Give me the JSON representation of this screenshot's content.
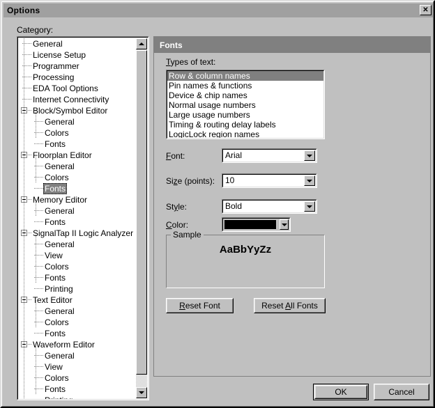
{
  "window": {
    "title": "Options",
    "close_label": "✕"
  },
  "left": {
    "category_label": "Category:",
    "tree": [
      {
        "label": "General",
        "depth": 1,
        "expander": false
      },
      {
        "label": "License Setup",
        "depth": 1,
        "expander": false
      },
      {
        "label": "Programmer",
        "depth": 1,
        "expander": false
      },
      {
        "label": "Processing",
        "depth": 1,
        "expander": false
      },
      {
        "label": "EDA Tool Options",
        "depth": 1,
        "expander": false
      },
      {
        "label": "Internet Connectivity",
        "depth": 1,
        "expander": false
      },
      {
        "label": "Block/Symbol Editor",
        "depth": 1,
        "expander": true
      },
      {
        "label": "General",
        "depth": 2,
        "expander": false
      },
      {
        "label": "Colors",
        "depth": 2,
        "expander": false
      },
      {
        "label": "Fonts",
        "depth": 2,
        "expander": false
      },
      {
        "label": "Floorplan Editor",
        "depth": 1,
        "expander": true
      },
      {
        "label": "General",
        "depth": 2,
        "expander": false
      },
      {
        "label": "Colors",
        "depth": 2,
        "expander": false
      },
      {
        "label": "Fonts",
        "depth": 2,
        "expander": false,
        "selected": true
      },
      {
        "label": "Memory Editor",
        "depth": 1,
        "expander": true
      },
      {
        "label": "General",
        "depth": 2,
        "expander": false
      },
      {
        "label": "Fonts",
        "depth": 2,
        "expander": false
      },
      {
        "label": "SignalTap II Logic Analyzer",
        "depth": 1,
        "expander": true
      },
      {
        "label": "General",
        "depth": 2,
        "expander": false
      },
      {
        "label": "View",
        "depth": 2,
        "expander": false
      },
      {
        "label": "Colors",
        "depth": 2,
        "expander": false
      },
      {
        "label": "Fonts",
        "depth": 2,
        "expander": false
      },
      {
        "label": "Printing",
        "depth": 2,
        "expander": false
      },
      {
        "label": "Text Editor",
        "depth": 1,
        "expander": true
      },
      {
        "label": "General",
        "depth": 2,
        "expander": false
      },
      {
        "label": "Colors",
        "depth": 2,
        "expander": false
      },
      {
        "label": "Fonts",
        "depth": 2,
        "expander": false
      },
      {
        "label": "Waveform Editor",
        "depth": 1,
        "expander": true
      },
      {
        "label": "General",
        "depth": 2,
        "expander": false
      },
      {
        "label": "View",
        "depth": 2,
        "expander": false
      },
      {
        "label": "Colors",
        "depth": 2,
        "expander": false
      },
      {
        "label": "Fonts",
        "depth": 2,
        "expander": false
      },
      {
        "label": "Printing",
        "depth": 2,
        "expander": false
      }
    ]
  },
  "panel": {
    "header": "Fonts",
    "types_label_pre": "T",
    "types_label_post": "ypes of text:",
    "types_of_text": [
      {
        "label": "Row & column names",
        "selected": true
      },
      {
        "label": "Pin names & functions",
        "selected": false
      },
      {
        "label": "Device & chip names",
        "selected": false
      },
      {
        "label": "Normal usage numbers",
        "selected": false
      },
      {
        "label": "Large usage numbers",
        "selected": false
      },
      {
        "label": "Timing & routing delay labels",
        "selected": false
      },
      {
        "label": "LogicLock region names",
        "selected": false
      }
    ],
    "font": {
      "label_pre": "F",
      "label_mn": "o",
      "label_post": "nt:",
      "value": "Arial"
    },
    "size": {
      "label_pre": "Si",
      "label_mn": "z",
      "label_post": "e (points):",
      "value": "10"
    },
    "style": {
      "label_pre": "St",
      "label_mn": "y",
      "label_post": "le:",
      "value": "Bold"
    },
    "color": {
      "label_pre": "C",
      "label_mn": "o",
      "label_post": "lor:",
      "value": "#000000"
    },
    "sample": {
      "legend": "Sample",
      "text": "AaBbYyZz"
    },
    "reset_font": {
      "pre": "R",
      "mn": "",
      "post": "eset Font",
      "full": "Reset Font"
    },
    "reset_all": {
      "pre": "Reset ",
      "mn": "A",
      "post": "ll Fonts",
      "full": "Reset All Fonts"
    }
  },
  "footer": {
    "ok": "OK",
    "cancel": "Cancel"
  },
  "icons": {
    "combo_arrow": "▼",
    "scroll_up": "up-arrow-icon",
    "scroll_down": "down-arrow-icon"
  }
}
